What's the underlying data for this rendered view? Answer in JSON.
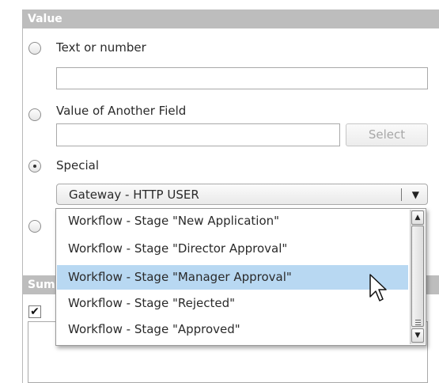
{
  "value_section": {
    "header": "Value",
    "text_or_number": {
      "label": "Text or number",
      "value": ""
    },
    "another_field": {
      "label": "Value of Another Field",
      "value": "",
      "select_label": "Select"
    },
    "special": {
      "label": "Special",
      "selected": true,
      "combo_value": "Gateway - HTTP USER",
      "dropdown_arrow": "▼"
    }
  },
  "summary_section": {
    "header_partial": "Sum",
    "checkbox_checked": true
  },
  "dropdown": {
    "items": [
      {
        "label": "Workflow - Stage \"New Application\"",
        "selected": false
      },
      {
        "label": "Workflow - Stage \"Director Approval\"",
        "selected": false
      },
      {
        "label": "Workflow - Stage \"Manager Approval\"",
        "selected": true
      },
      {
        "label": "Workflow - Stage \"Rejected\"",
        "selected": false
      },
      {
        "label": "Workflow - Stage \"Approved\"",
        "selected": false
      }
    ],
    "scroll_up": "▲",
    "scroll_down": "▼",
    "highlight_color": "#b8d8f2"
  }
}
